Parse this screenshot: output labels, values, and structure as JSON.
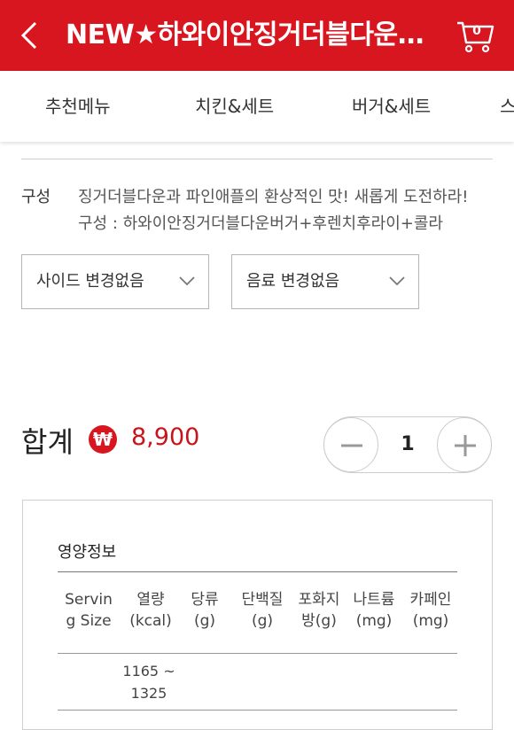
{
  "header": {
    "title": "NEW★하와이안징거더블다운세트",
    "cart_count": "0",
    "color": "#d8161f"
  },
  "tabs": [
    {
      "label": "추천메뉴"
    },
    {
      "label": "치킨&세트"
    },
    {
      "label": "버거&세트"
    },
    {
      "label": "스"
    }
  ],
  "composition": {
    "label": "구성",
    "description": "징거더블다운과 파인애플의 환상적인 맛! 새롭게 도전하라!",
    "items": "구성 : 하와이안징거더블다운버거+후렌치후라이+콜라"
  },
  "options": {
    "side": "사이드 변경없음",
    "drink": "음료 변경없음"
  },
  "total": {
    "label": "합계",
    "currency_symbol": "₩",
    "price": "8,900"
  },
  "quantity": {
    "minus": "−",
    "value": "1",
    "plus": "+"
  },
  "nutrition": {
    "title": "영양정보",
    "headers": [
      "Serving Size",
      "열량 (kcal)",
      "당류 (g)",
      "단백질 (g)",
      "포화지방(g)",
      "나트륨 (mg)",
      "카페인 (mg)"
    ],
    "row": {
      "serving_size": "",
      "calories": "1165 ~ 1325"
    }
  }
}
